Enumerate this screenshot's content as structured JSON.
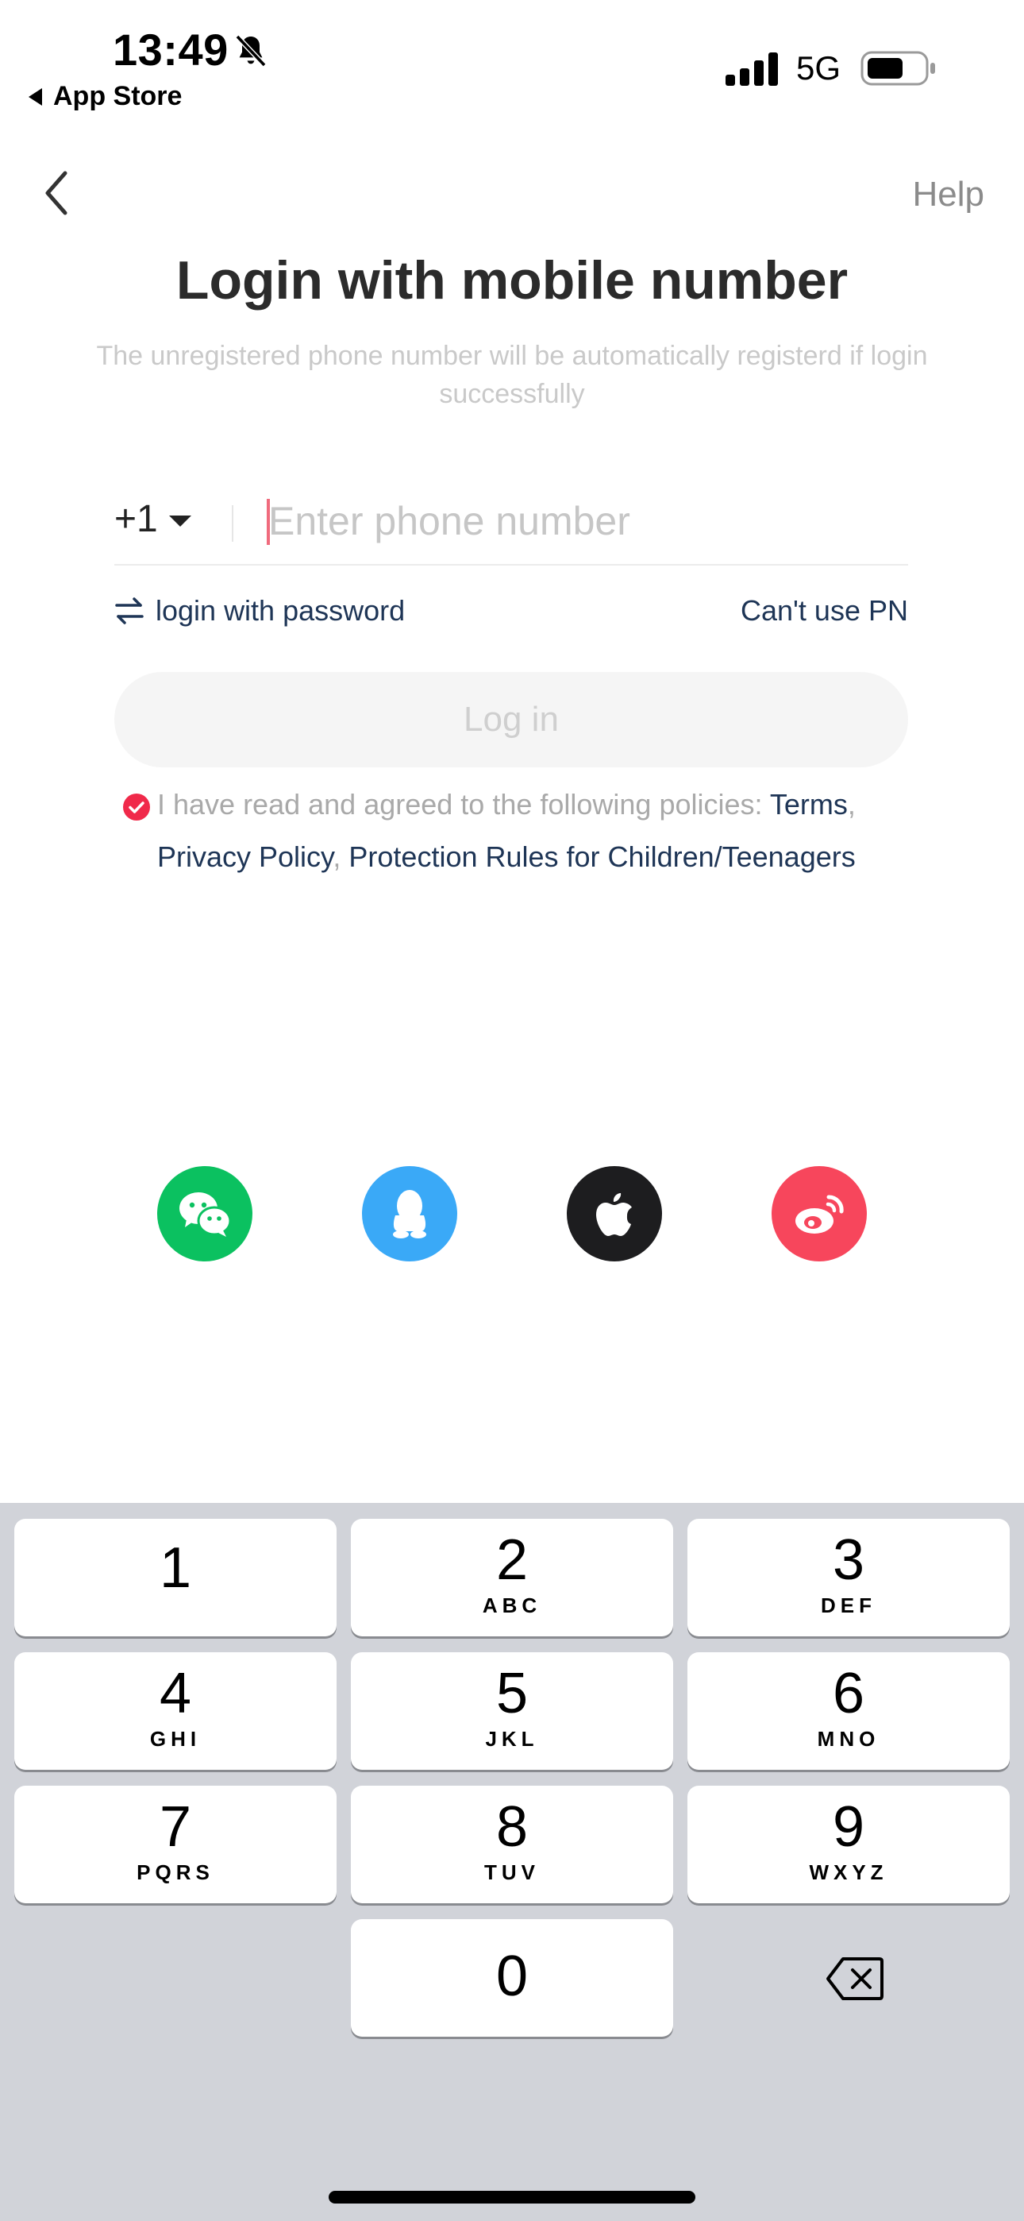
{
  "status_bar": {
    "time": "13:49",
    "back_app": "App Store",
    "network": "5G"
  },
  "nav": {
    "help": "Help"
  },
  "login": {
    "title": "Login with mobile number",
    "subtitle": "The unregistered phone number will be automatically registerd if login successfully",
    "country_code": "+1",
    "phone_placeholder": "Enter phone number",
    "phone_value": "",
    "password_link": "login with password",
    "cant_use_link": "Can't use PN",
    "login_button": "Log in",
    "agreement": {
      "checked": true,
      "prefix": "I have read and agreed to the following policies: ",
      "terms": "Terms",
      "comma1": ",",
      "privacy": "Privacy Policy",
      "comma2": ", ",
      "protection": "Protection Rules for Children/Teenagers"
    }
  },
  "social_logins": [
    {
      "name": "wechat-icon",
      "color": "#0bc160"
    },
    {
      "name": "qq-icon",
      "color": "#3aa9f7"
    },
    {
      "name": "apple-icon",
      "color": "#1d1d1f"
    },
    {
      "name": "weibo-icon",
      "color": "#f7465c"
    }
  ],
  "keypad": {
    "keys": [
      {
        "num": "1",
        "letters": ""
      },
      {
        "num": "2",
        "letters": "ABC"
      },
      {
        "num": "3",
        "letters": "DEF"
      },
      {
        "num": "4",
        "letters": "GHI"
      },
      {
        "num": "5",
        "letters": "JKL"
      },
      {
        "num": "6",
        "letters": "MNO"
      },
      {
        "num": "7",
        "letters": "PQRS"
      },
      {
        "num": "8",
        "letters": "TUV"
      },
      {
        "num": "9",
        "letters": "WXYZ"
      },
      {
        "num": "0",
        "letters": ""
      }
    ]
  },
  "colors": {
    "accent_red": "#f0294a",
    "link_navy": "#1e3556",
    "keypad_bg": "#d1d3d9"
  }
}
